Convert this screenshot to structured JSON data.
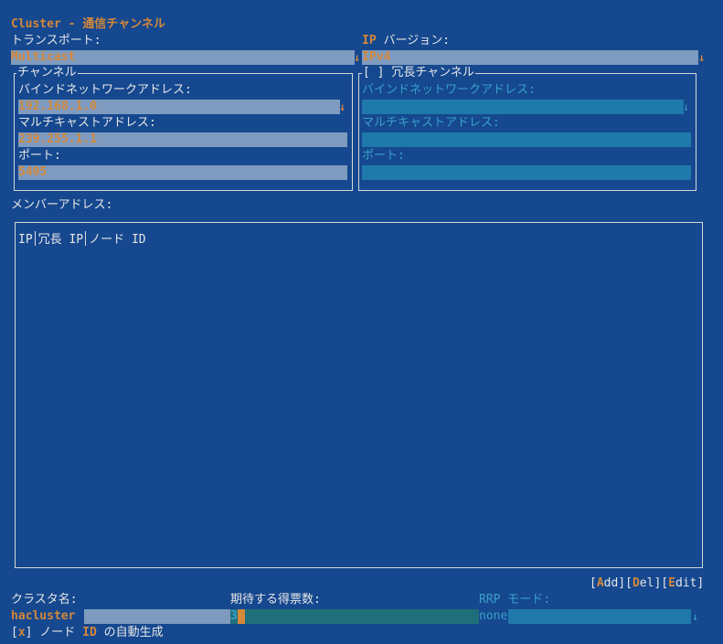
{
  "window": {
    "title": "Cluster - 通信チャンネル"
  },
  "transport": {
    "label": "トランスポート:",
    "value": "Multicast"
  },
  "ip_version": {
    "label_hot": "IP",
    "label_rest": " バージョン:",
    "value": "IPv4"
  },
  "channel": {
    "title": "チャンネル",
    "bind_label": "バインドネットワークアドレス:",
    "bind_value": "192.168.1.0",
    "mcast_label": "マルチキャストアドレス:",
    "mcast_value": "239.255.1.1",
    "port_label": "ポート:",
    "port_value": "5405"
  },
  "redundant": {
    "checkbox": "[ ]",
    "title": "冗長チャンネル",
    "bind_label": "バインドネットワークアドレス:",
    "mcast_label": "マルチキャストアドレス:",
    "port_label": "ポート:"
  },
  "members": {
    "label": "メンバーアドレス:",
    "columns": [
      "IP",
      "冗長 IP",
      "ノード ID"
    ]
  },
  "actions": {
    "add_open": "[",
    "add_hot": "A",
    "add_rest": "dd]",
    "del_open": "[",
    "del_hot": "D",
    "del_rest": "el]",
    "edit_open": "[",
    "edit_hot": "E",
    "edit_rest": "dit]"
  },
  "cluster_name": {
    "label": "クラスタ名:",
    "value": "hacluster"
  },
  "expected_votes": {
    "label": "期待する得票数:",
    "value": "3"
  },
  "rrp_mode": {
    "label": "RRP モード:",
    "value": "none"
  },
  "auto_node_id": {
    "box_open": "[",
    "mark": "x",
    "box_close": "]",
    "label_a": " ノード ",
    "label_hot": "ID",
    "label_b": " の自動生成"
  }
}
